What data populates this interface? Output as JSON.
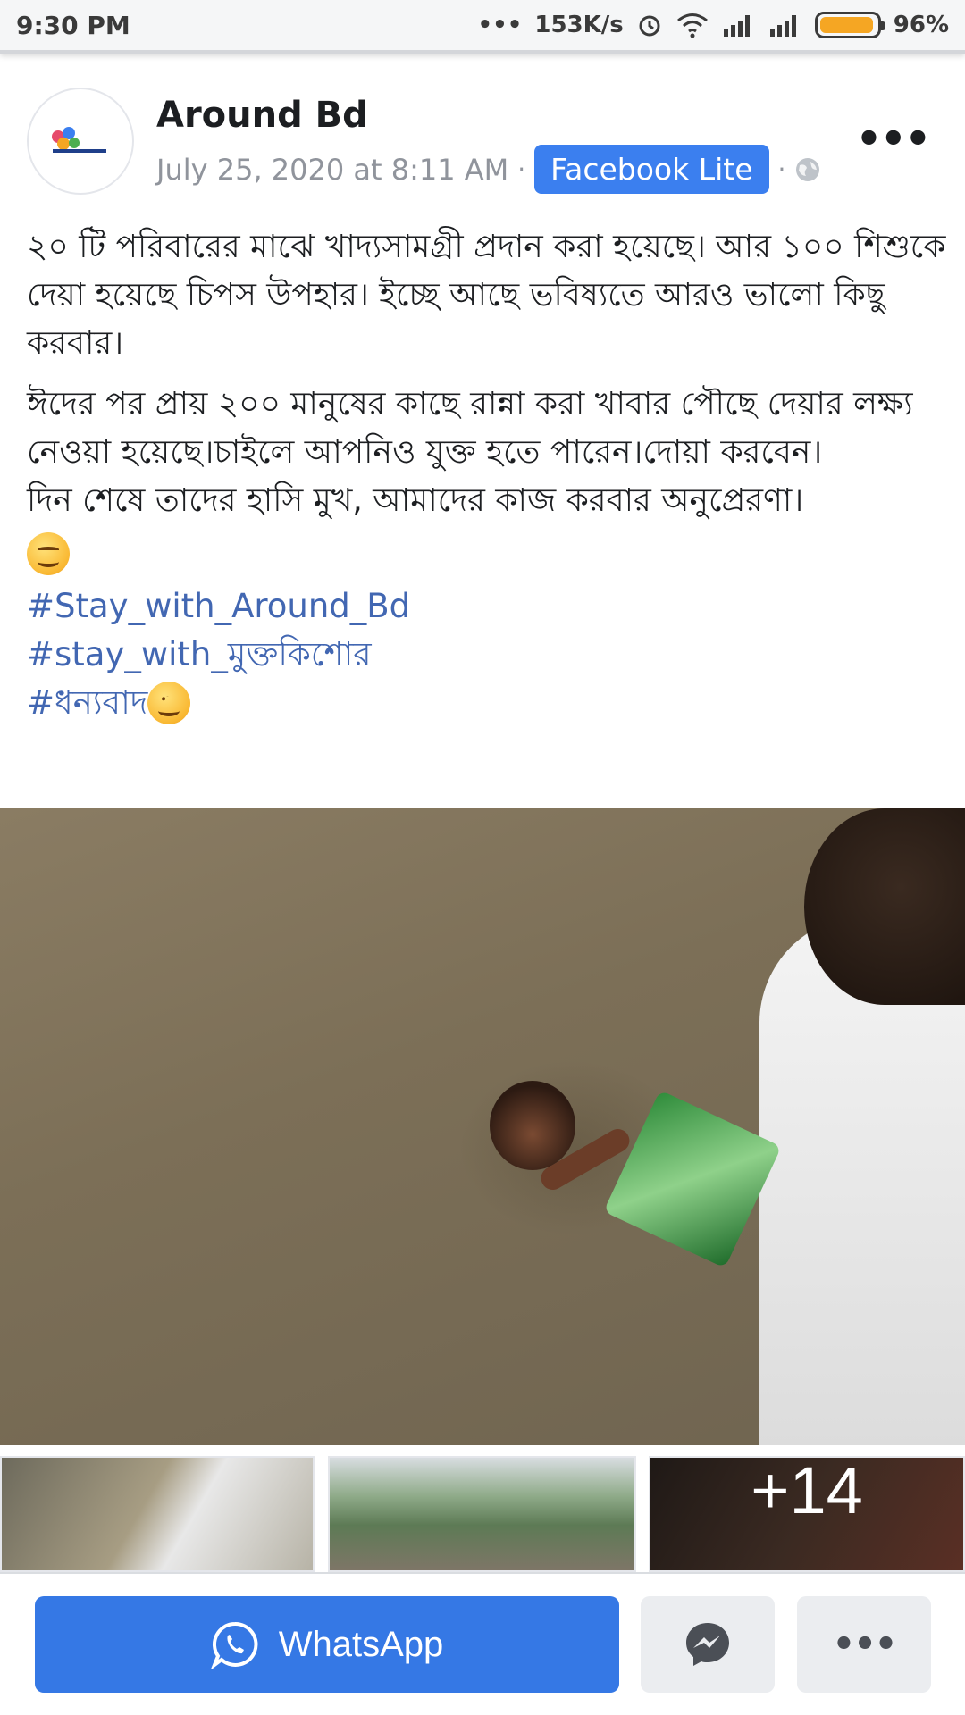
{
  "status_bar": {
    "time": "9:30 PM",
    "network_speed": "153K/s",
    "battery_percent": "96%",
    "battery_level": 0.96,
    "dots": "•••",
    "icons": [
      "alarm-icon",
      "wifi-icon",
      "signal-icon",
      "signal-icon",
      "battery-icon"
    ]
  },
  "post": {
    "page_name": "Around Bd",
    "date": "July 25, 2020 at 8:11 AM",
    "separator": "·",
    "app_badge": "Facebook Lite",
    "privacy_icon": "globe-icon",
    "more_label": "•••",
    "paragraph_1": "২০ টি পরিবারের মাঝে খাদ্যসামগ্রী প্রদান করা হয়েছে। আর ১০০ শিশুকে দেয়া হয়েছে চিপস উপহার। ইচ্ছে আছে ভবিষ্যতে আরও ভালো কিছু করবার।",
    "paragraph_2": "ঈদের পর প্রায় ২০০ মানুষের কাছে রান্না করা খাবার পৌছে দেয়ার লক্ষ্য নেওয়া হয়েছে।চাইলে আপনিও যুক্ত হতে পারেন।দোয়া করবেন।",
    "paragraph_3": "দিন শেষে তাদের হাসি মুখ, আমাদের কাজ করবার অনুপ্রেরণা।",
    "hashtags": [
      "#Stay_with_Around_Bd",
      "#stay_with_মুক্তকিশোর",
      "#ধন্যবাদ"
    ]
  },
  "photos": {
    "main_alt": "boy in flood water receiving chips packet",
    "more_count": "+14"
  },
  "share": {
    "whatsapp_label": "WhatsApp",
    "more_label": "•••"
  }
}
